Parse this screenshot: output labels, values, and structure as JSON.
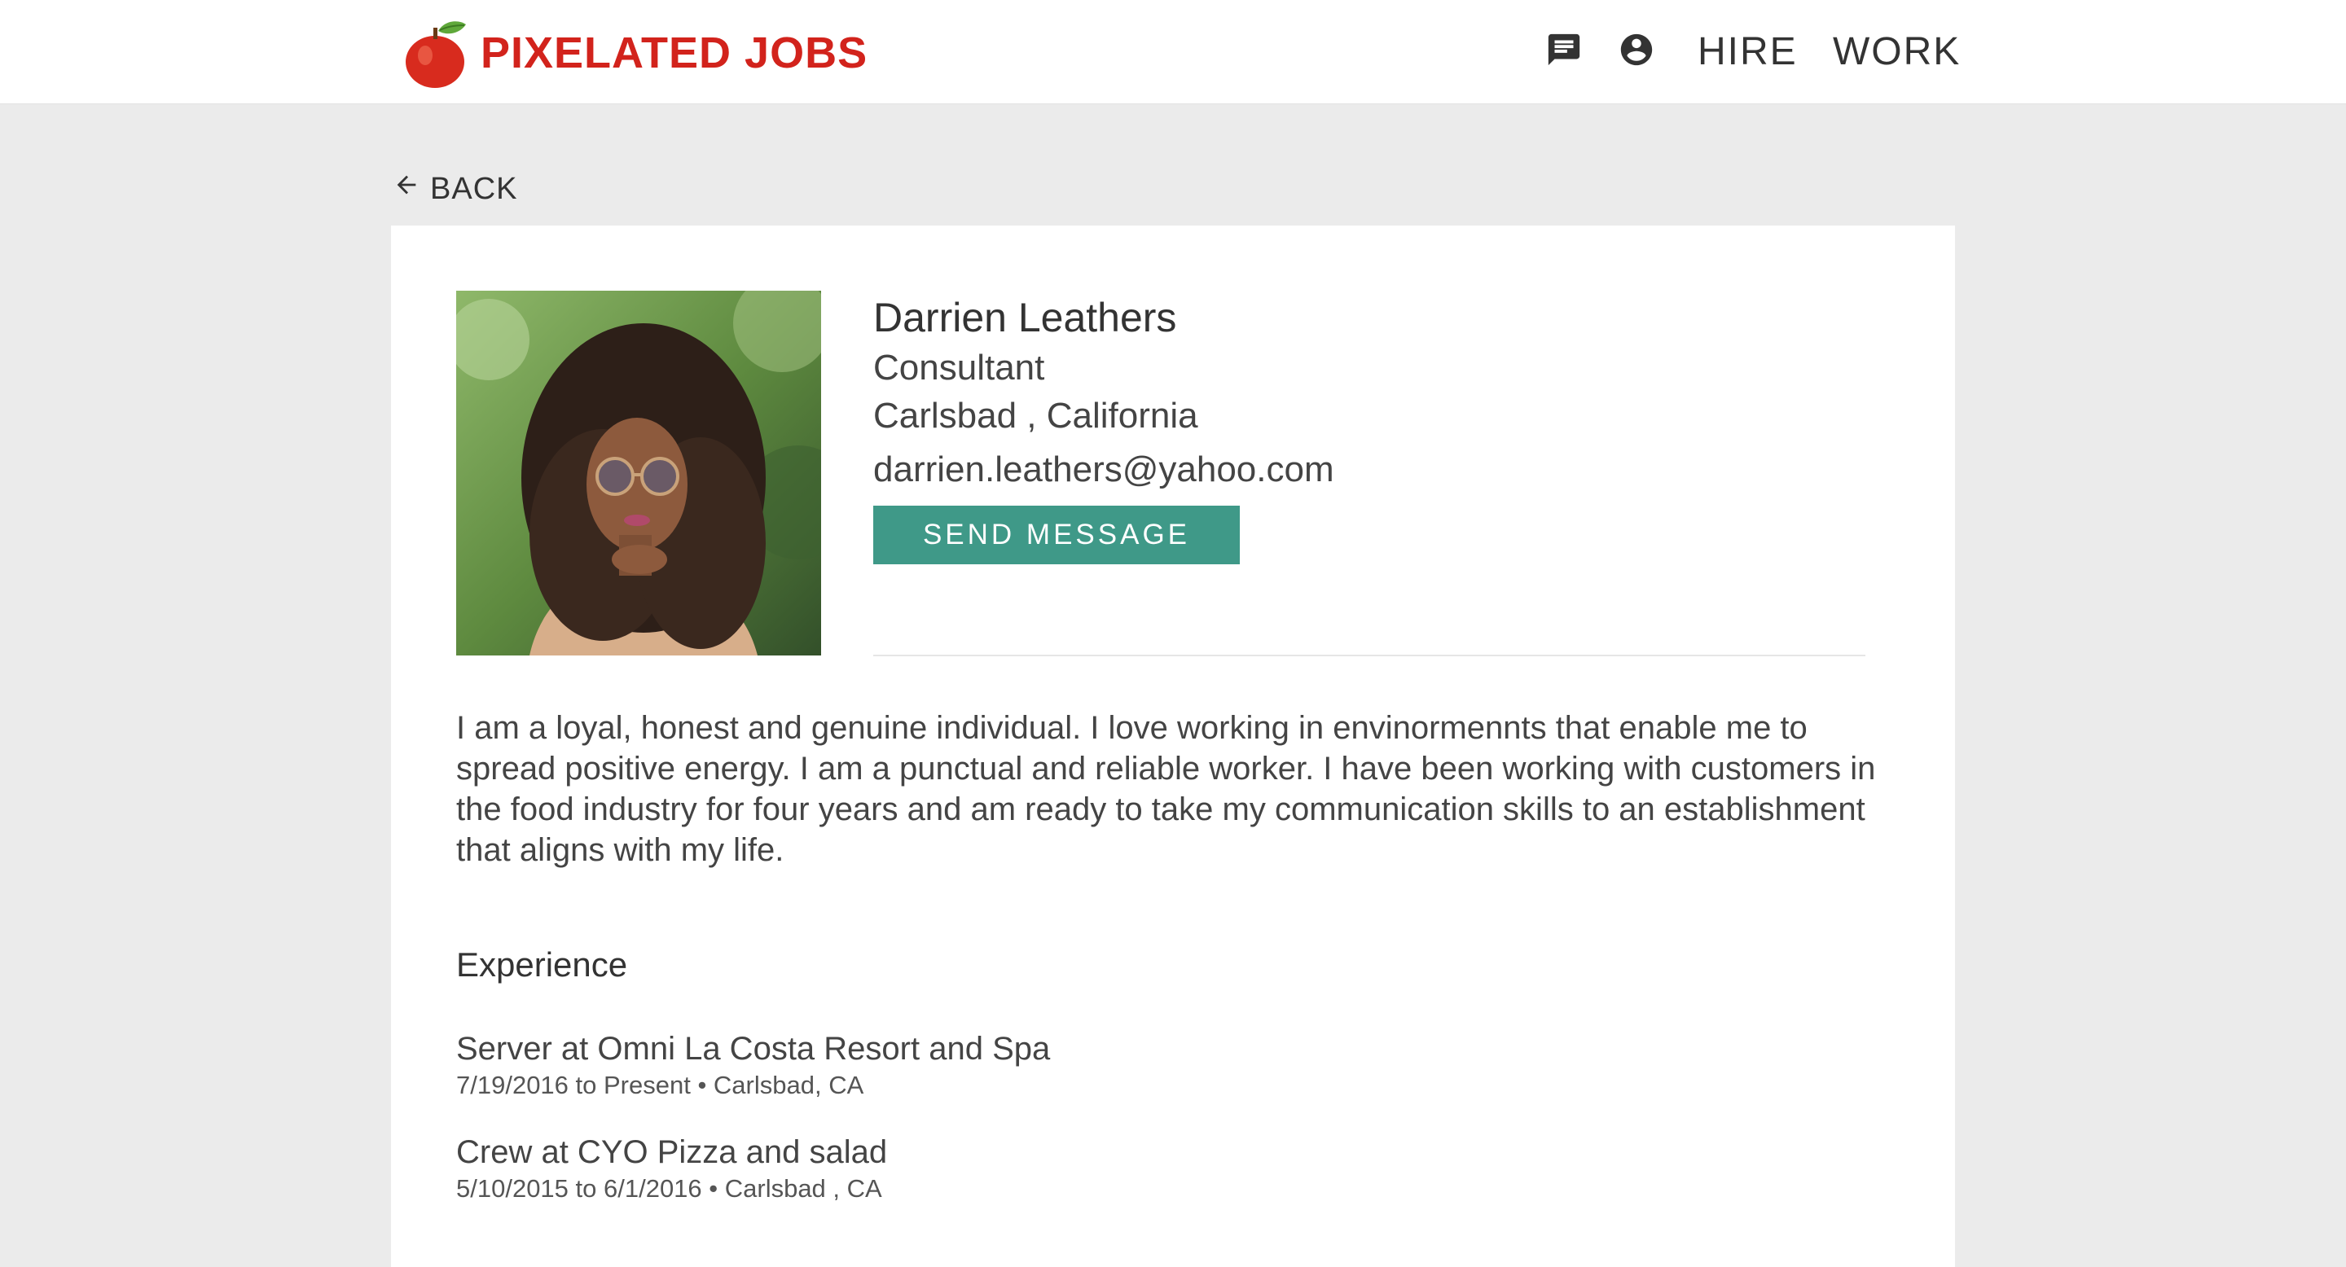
{
  "header": {
    "brand": "PIXELATED JOBS",
    "icons": [
      "chat-icon",
      "account-icon"
    ],
    "nav": [
      {
        "label": "HIRE"
      },
      {
        "label": "WORK"
      }
    ]
  },
  "back_label": "BACK",
  "profile": {
    "name": "Darrien Leathers",
    "title": "Consultant",
    "location": "Carlsbad , California",
    "email": "darrien.leathers@yahoo.com",
    "send_button": "SEND MESSAGE",
    "bio": "I am a loyal, honest and genuine individual. I love working in envinormennts that enable me to spread positive energy. I am  a punctual and reliable worker. I have been working with customers in the food industry for four years and am ready to take my communication skills to an establishment that aligns with my life."
  },
  "experience": {
    "heading": "Experience",
    "items": [
      {
        "title": "Server at Omni La Costa Resort and Spa",
        "meta": "7/19/2016 to Present • Carlsbad, CA"
      },
      {
        "title": "Crew at CYO Pizza and salad",
        "meta": "5/10/2015 to 6/1/2016 • Carlsbad , CA"
      }
    ]
  },
  "colors": {
    "brand_red": "#d2231c",
    "accent_teal": "#3f9988",
    "page_bg": "#ebebeb"
  }
}
